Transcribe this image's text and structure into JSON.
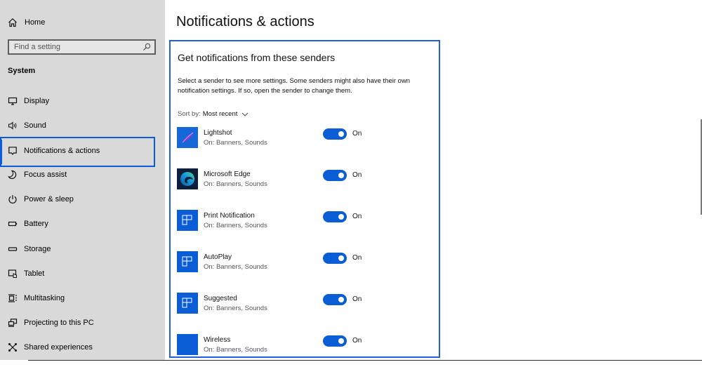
{
  "sidebar": {
    "home_label": "Home",
    "search_placeholder": "Find a setting",
    "section_title": "System",
    "items": [
      {
        "label": "Display",
        "icon": "display-icon"
      },
      {
        "label": "Sound",
        "icon": "speaker-icon"
      },
      {
        "label": "Notifications & actions",
        "icon": "notification-icon",
        "selected": true
      },
      {
        "label": "Focus assist",
        "icon": "moon-icon"
      },
      {
        "label": "Power & sleep",
        "icon": "power-icon"
      },
      {
        "label": "Battery",
        "icon": "battery-icon"
      },
      {
        "label": "Storage",
        "icon": "storage-icon"
      },
      {
        "label": "Tablet",
        "icon": "tablet-icon"
      },
      {
        "label": "Multitasking",
        "icon": "multitasking-icon"
      },
      {
        "label": "Projecting to this PC",
        "icon": "projecting-icon"
      },
      {
        "label": "Shared experiences",
        "icon": "shared-experiences-icon"
      }
    ]
  },
  "main": {
    "page_title": "Notifications & actions",
    "panel": {
      "title": "Get notifications from these senders",
      "description": "Select a sender to see more settings. Some senders might also have their own notification settings. If so, open the sender to change them.",
      "sort_label": "Sort by:",
      "sort_value": "Most recent",
      "senders": [
        {
          "name": "Lightshot",
          "status": "On: Banners, Sounds",
          "toggle_label": "On",
          "enabled": true,
          "icon": "lightshot-icon"
        },
        {
          "name": "Microsoft Edge",
          "status": "On: Banners, Sounds",
          "toggle_label": "On",
          "enabled": true,
          "icon": "edge-icon"
        },
        {
          "name": "Print Notification",
          "status": "On: Banners, Sounds",
          "toggle_label": "On",
          "enabled": true,
          "icon": "app-tile-icon"
        },
        {
          "name": "AutoPlay",
          "status": "On: Banners, Sounds",
          "toggle_label": "On",
          "enabled": true,
          "icon": "app-tile-icon"
        },
        {
          "name": "Suggested",
          "status": "On: Banners, Sounds",
          "toggle_label": "On",
          "enabled": true,
          "icon": "app-tile-icon"
        },
        {
          "name": "Wireless",
          "status": "On: Banners, Sounds",
          "toggle_label": "On",
          "enabled": true,
          "icon": "blank-tile-icon"
        }
      ]
    }
  },
  "colors": {
    "accent": "#0a5dd4",
    "focus_outline": "#1f5fe6",
    "sidebar_bg": "#d9d9d9"
  }
}
